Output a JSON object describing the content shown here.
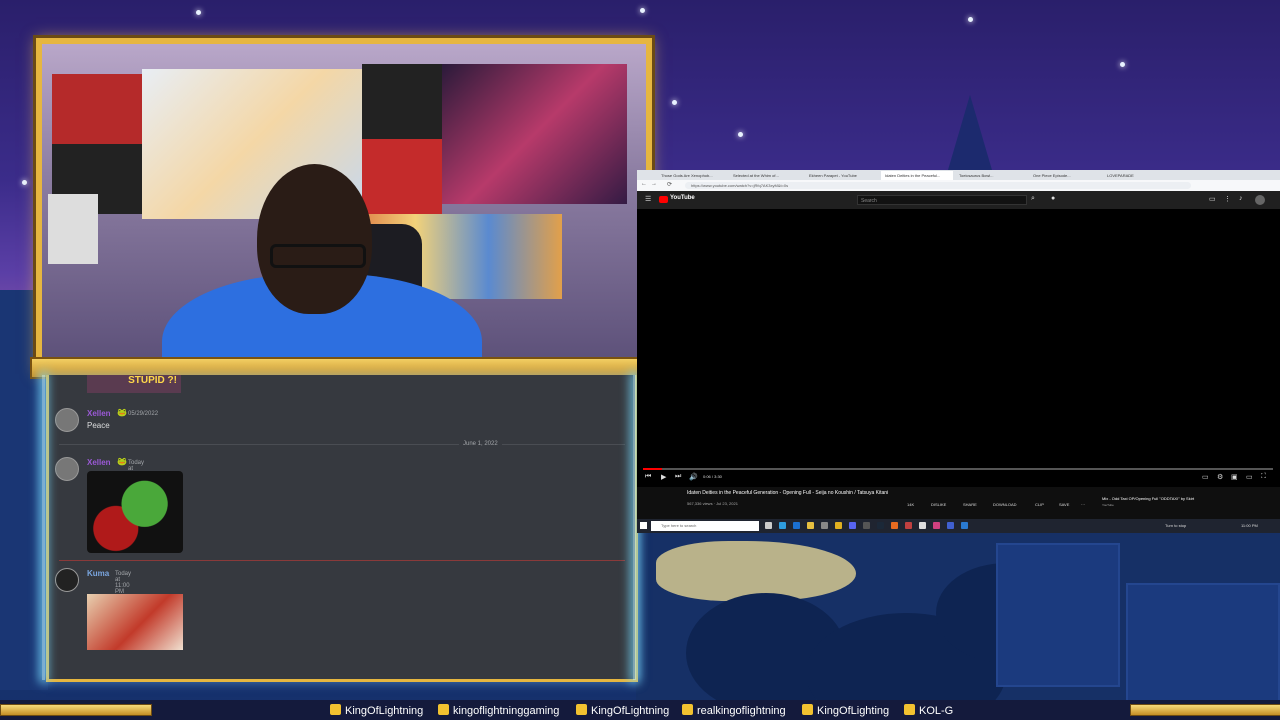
{
  "colors": {
    "gold": "#e6b640",
    "discord_bg": "#36393f",
    "xellen_name": "#9b59d6",
    "kuma_name": "#7aa6e0",
    "yt_red": "#ff0000"
  },
  "chat": {
    "messages": [
      {
        "user": "Xellen",
        "timestamp": "05/29/2022",
        "text": "Peace"
      },
      {
        "divider": "June 1, 2022"
      },
      {
        "user": "Xellen",
        "timestamp": "Today at 4:50 PM",
        "emote": "pepe-wine-emote"
      },
      {
        "user": "Kuma",
        "timestamp": "Today at 11:00 PM",
        "emote": "anime-character-emote"
      }
    ],
    "stupid_banner": "STUPID ?!"
  },
  "browser": {
    "tabs": [
      "Those Gods Are Xenophob...",
      "Selected at the Whim of...",
      "Ekheen Parapet - YouTube",
      "Idaten Deities in the Peaceful...",
      "Toeicsaurus Bowl...",
      "One Piece Episode...",
      "LOVEPARADE"
    ],
    "url": "https://www.youtube.com/watch?v=jRfq7AK3xyM&t=0s",
    "yt_logo": "YouTube",
    "search_placeholder": "Search",
    "time": "0:06 / 3:30",
    "progress": 0.03,
    "video_title": "Idaten Deities in the Peaceful Generation - Opening Full - Seija no Koushin / Tatsuya Kitani",
    "video_meta": "567,336 views · Jul 23, 2021",
    "actions": [
      "14K",
      "DISLIKE",
      "SHARE",
      "DOWNLOAD",
      "CLIP",
      "SAVE",
      "···"
    ],
    "side_title": "Mix - Odd Taxi OP/Opening Full \"ODDTAXI\" by Skirt",
    "side_channel": "YouTube",
    "taskbar_search": "Type here to search",
    "taskbar_tray": "Turn to stop",
    "clock": "11:00 PM"
  },
  "socials": [
    {
      "icon": "twitch-icon",
      "label": "KingOfLightning"
    },
    {
      "icon": "twitch-icon",
      "label": "kingoflightninggaming"
    },
    {
      "icon": "youtube-icon",
      "label": "KingOfLightning"
    },
    {
      "icon": "instagram-icon",
      "label": "realkingoflightning"
    },
    {
      "icon": "twitter-icon",
      "label": "KingOfLighting"
    },
    {
      "icon": "youtube-icon",
      "label": "KOL-G"
    }
  ]
}
